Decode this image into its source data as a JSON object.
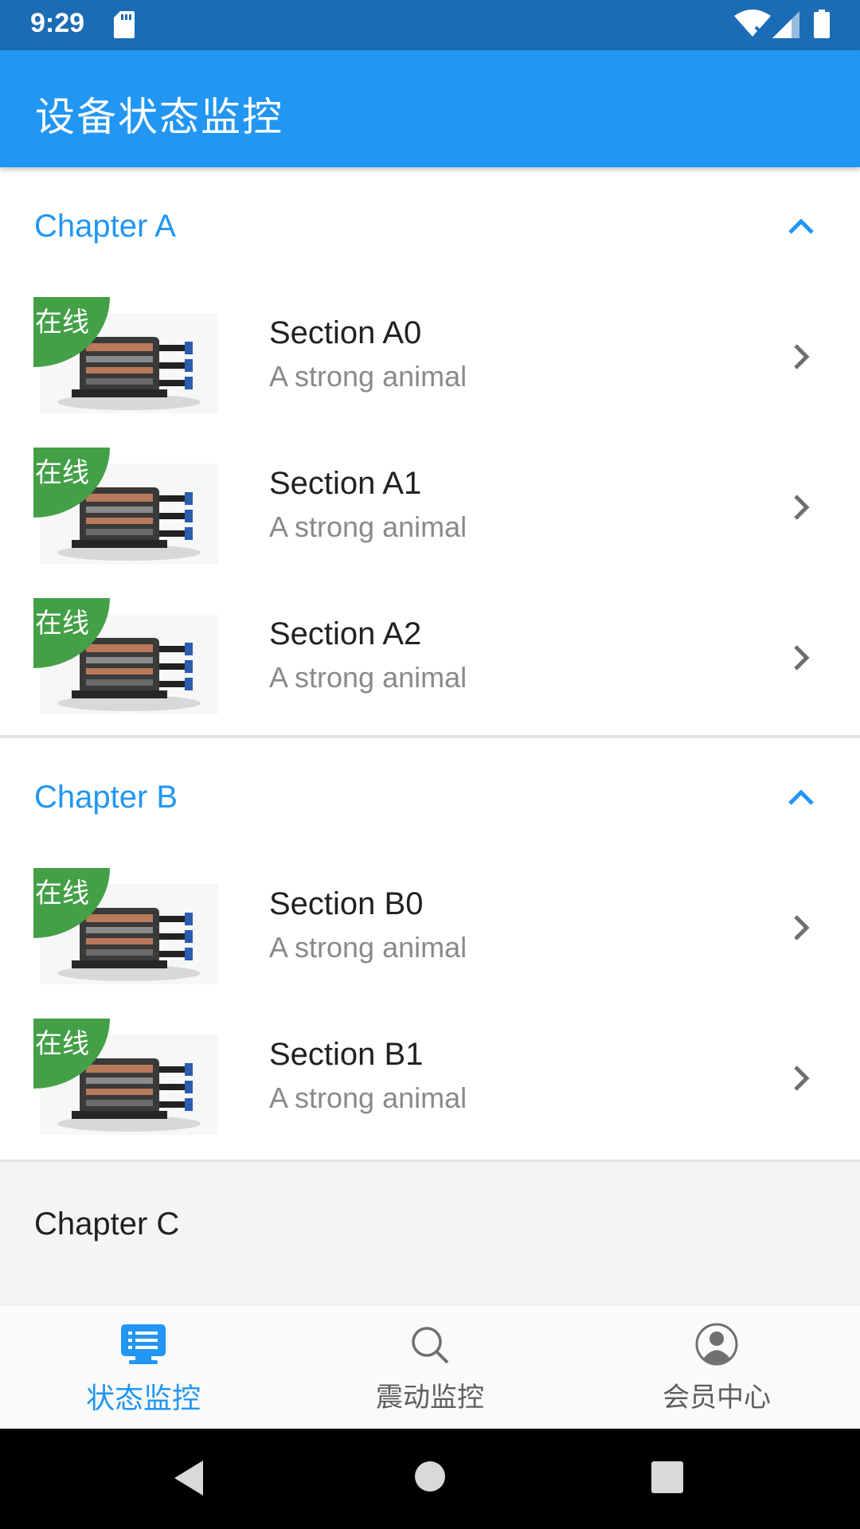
{
  "status_bar": {
    "time": "9:29",
    "icons": [
      "sd-card-icon",
      "wifi-icon",
      "signal-icon",
      "battery-icon"
    ]
  },
  "app_bar": {
    "title": "设备状态监控"
  },
  "chapters": [
    {
      "title": "Chapter A",
      "expanded": true,
      "items": [
        {
          "badge": "在线",
          "title": "Section A0",
          "subtitle": "A strong animal"
        },
        {
          "badge": "在线",
          "title": "Section A1",
          "subtitle": "A strong animal"
        },
        {
          "badge": "在线",
          "title": "Section A2",
          "subtitle": "A strong animal"
        }
      ]
    },
    {
      "title": "Chapter B",
      "expanded": true,
      "items": [
        {
          "badge": "在线",
          "title": "Section B0",
          "subtitle": "A strong animal"
        },
        {
          "badge": "在线",
          "title": "Section B1",
          "subtitle": "A strong animal"
        }
      ]
    },
    {
      "title": "Chapter C",
      "expanded": false,
      "items": []
    }
  ],
  "bottom_nav": {
    "items": [
      {
        "label": "状态监控",
        "icon": "monitor-list-icon",
        "active": true
      },
      {
        "label": "震动监控",
        "icon": "search-icon",
        "active": false
      },
      {
        "label": "会员中心",
        "icon": "account-icon",
        "active": false
      }
    ]
  },
  "colors": {
    "status_bar": "#1b6cb4",
    "primary": "#2196f3",
    "badge_online": "#43a047",
    "subtitle": "#8a8a8a",
    "background": "#f4f5f5"
  }
}
